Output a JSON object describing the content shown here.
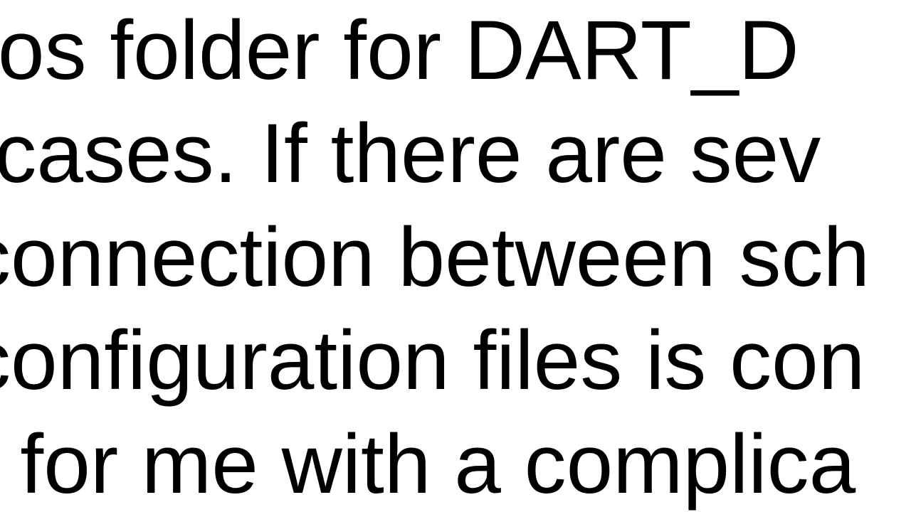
{
  "text": {
    "line1": "ur ios folder for DART_D",
    "line2": "e cases. If there are sev",
    "line3": "connection between sch",
    "line4": "configuration files is con",
    "line5": "n for me with a complica"
  }
}
